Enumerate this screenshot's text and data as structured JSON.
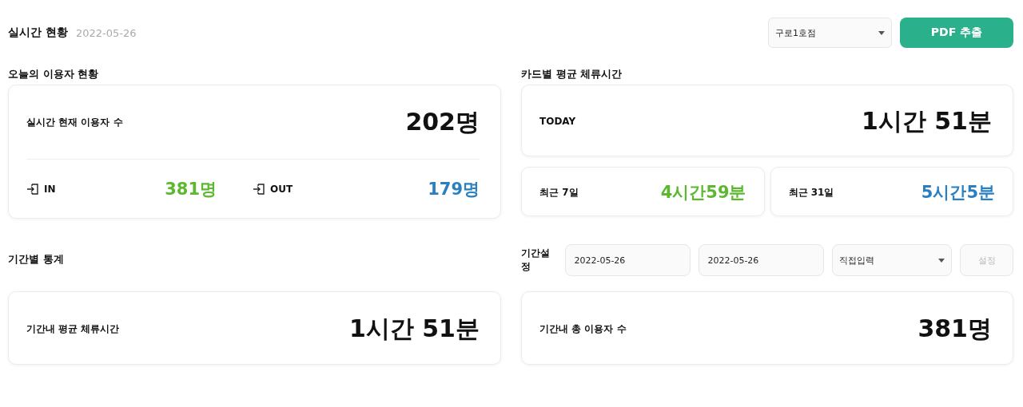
{
  "header": {
    "title": "실시간 현황",
    "date": "2022-05-26",
    "branch_select": {
      "value": "구로1호점"
    },
    "export_button": "PDF 추출"
  },
  "today_users": {
    "title": "오늘의 이용자 현황",
    "current_label": "실시간 현재 이용자 수",
    "current_value": "202명",
    "flows": [
      {
        "label": "IN",
        "value": "381명",
        "color": "#5cb82e"
      },
      {
        "label": "OUT",
        "value": "179명",
        "color": "#2a7fc1"
      }
    ]
  },
  "card_stay": {
    "title": "카드별 평균 체류시간",
    "today_label": "TODAY",
    "today_value": "1시간 51분",
    "recent": [
      {
        "label": "최근 7일",
        "value": "4시간59분",
        "color": "#5cb82e"
      },
      {
        "label": "최근 31일",
        "value": "5시간5분",
        "color": "#2a7fc1"
      }
    ]
  },
  "period": {
    "title": "기간별 통계",
    "setting_label": "기간설정",
    "start_date": "2022-05-26",
    "end_date": "2022-05-26",
    "range_select": {
      "value": "직접입력"
    },
    "apply_button": {
      "label": "설정",
      "disabled": true
    },
    "stats": [
      {
        "label": "기간내 평균 체류시간",
        "value": "1시간 51분"
      },
      {
        "label": "기간내 총 이용자 수",
        "value": "381명"
      }
    ]
  }
}
